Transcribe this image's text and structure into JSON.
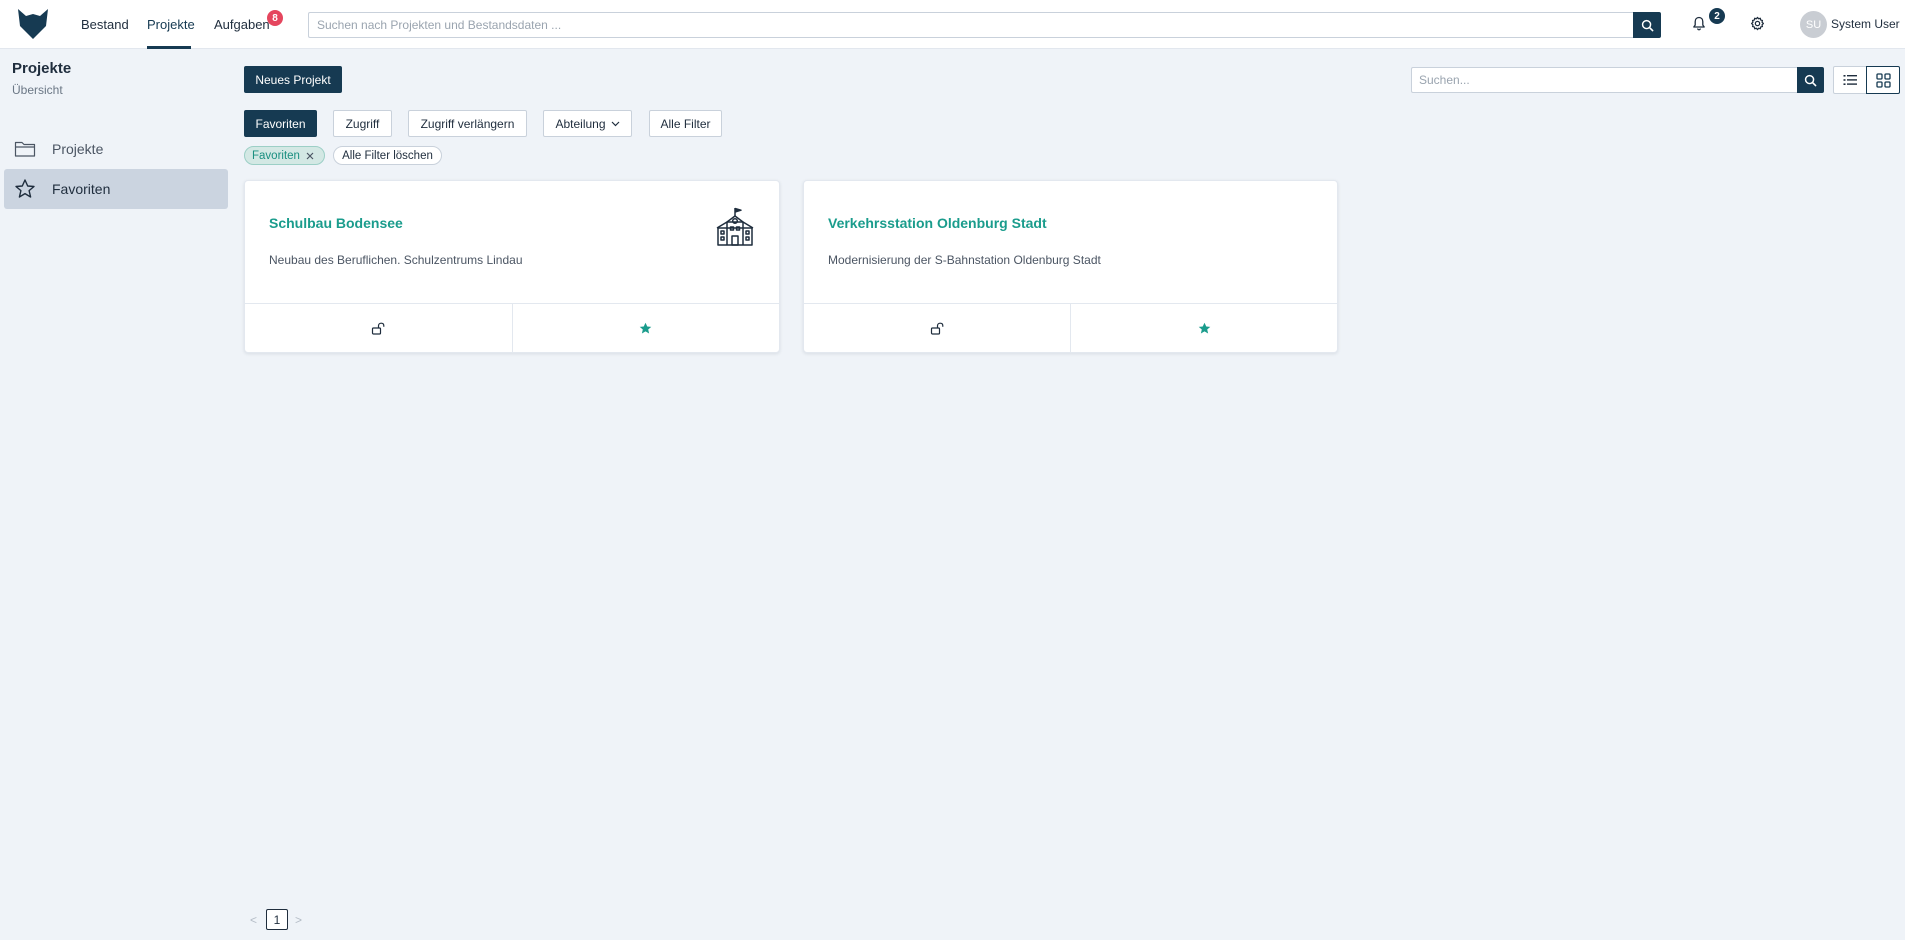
{
  "nav": {
    "items": [
      {
        "label": "Bestand"
      },
      {
        "label": "Projekte",
        "active": true
      },
      {
        "label": "Aufgaben",
        "badge": "8"
      }
    ],
    "search_placeholder": "Suchen nach Projekten und Bestandsdaten ...",
    "notifications_count": "2",
    "user": {
      "initials": "SU",
      "name": "System User"
    }
  },
  "sidebar": {
    "title": "Projekte",
    "subtitle": "Übersicht",
    "items": [
      {
        "label": "Projekte",
        "icon": "folder-icon"
      },
      {
        "label": "Favoriten",
        "icon": "star-icon",
        "active": true
      }
    ]
  },
  "toolbar": {
    "new_project_label": "Neues Projekt",
    "search_placeholder": "Suchen...",
    "active_view": "grid"
  },
  "filters": {
    "buttons": [
      {
        "label": "Favoriten",
        "active": true
      },
      {
        "label": "Zugriff"
      },
      {
        "label": "Zugriff verlängern"
      },
      {
        "label": "Abteilung",
        "dropdown": true
      },
      {
        "label": "Alle Filter"
      }
    ],
    "active_chips": [
      {
        "label": "Favoriten"
      }
    ],
    "clear_label": "Alle Filter löschen"
  },
  "projects": [
    {
      "title": "Schulbau Bodensee",
      "description": "Neubau des Beruflichen. Schulzentrums Lindau",
      "icon": "school-building-icon",
      "favorite": true
    },
    {
      "title": "Verkehrsstation Oldenburg Stadt",
      "description": "Modernisierung der S-Bahnstation Oldenburg Stadt",
      "favorite": true
    }
  ],
  "pagination": {
    "current_page": "1",
    "prev": "<",
    "next": ">"
  },
  "colors": {
    "primary": "#163a52",
    "accent": "#1a9c8c",
    "badge_red": "#e5465e",
    "background": "#eff3f8"
  }
}
